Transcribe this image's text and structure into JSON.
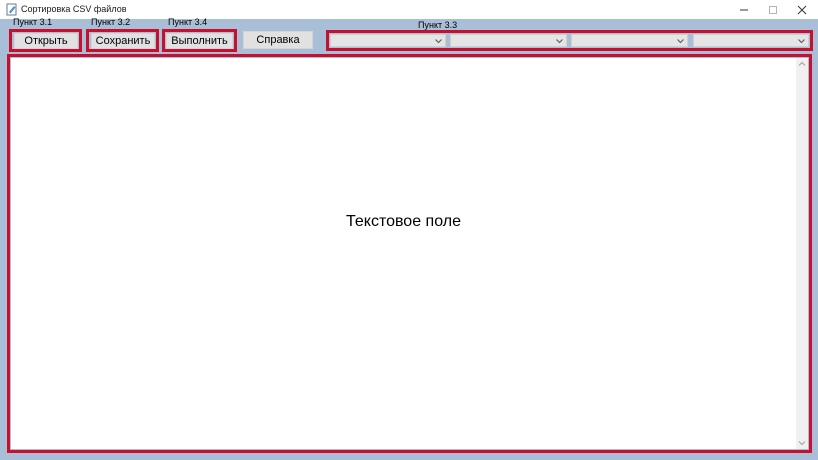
{
  "window": {
    "title": "Сортировка CSV файлов"
  },
  "callouts": {
    "open": "Пункт 3.1",
    "save": "Пункт 3.2",
    "execute": "Пункт 3.4",
    "combos": "Пункт 3.3"
  },
  "toolbar": {
    "open_label": "Открыть",
    "save_label": "Сохранить",
    "execute_label": "Выполнить",
    "help_label": "Справка"
  },
  "combos": [
    {
      "value": ""
    },
    {
      "value": ""
    },
    {
      "value": ""
    },
    {
      "value": ""
    }
  ],
  "text_field": {
    "label": "Текстовое поле"
  },
  "colors": {
    "window_background": "#a9bfd8",
    "highlight": "#c8102e",
    "button_face": "#e1e1e1"
  }
}
